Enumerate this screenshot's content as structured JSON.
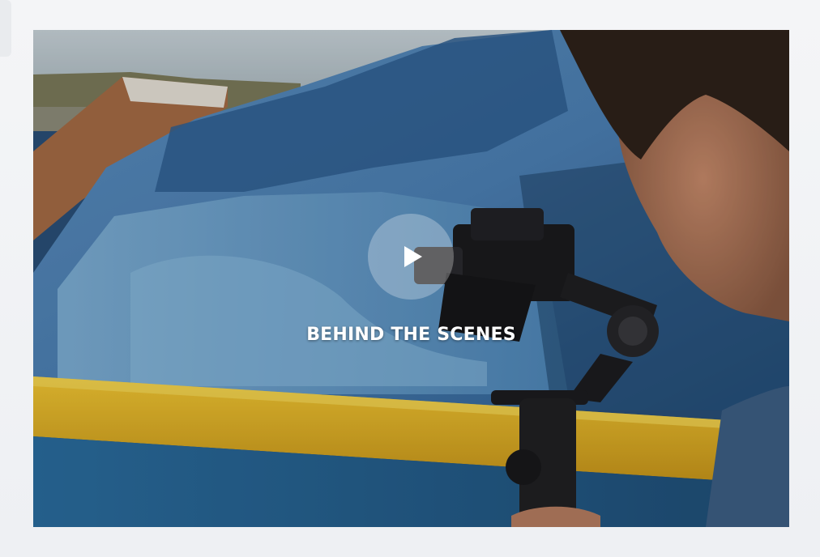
{
  "video": {
    "title": "BEHIND THE SCENES",
    "play_icon": "play-icon",
    "accent_colors": {
      "sky": "#b9c7cf",
      "tarp_blue": "#3f77ab",
      "boat_yellow": "#e8b92a",
      "hull_blue": "#2f6a9a"
    }
  }
}
